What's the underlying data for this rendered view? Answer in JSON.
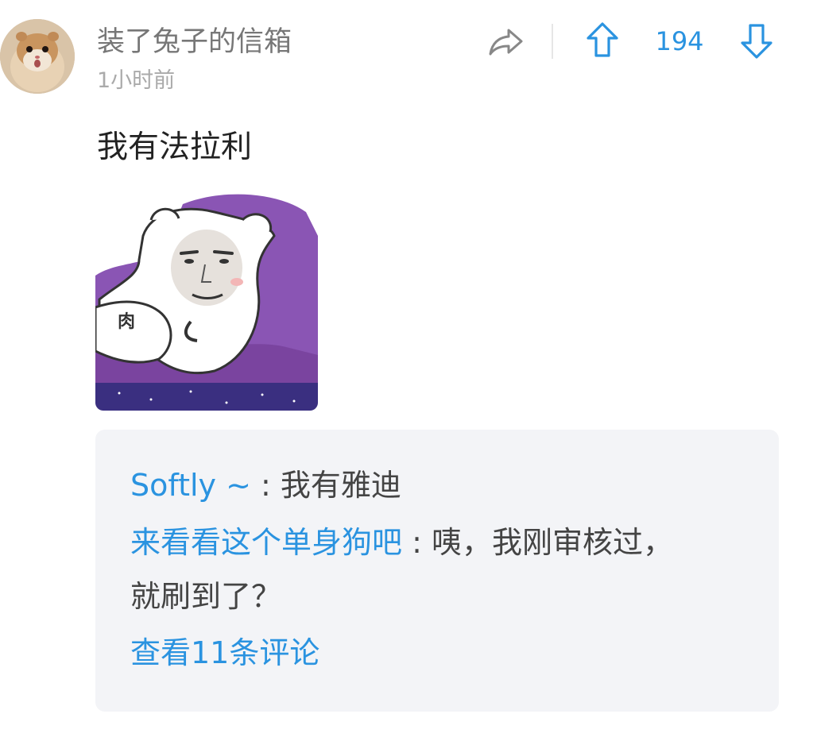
{
  "comment": {
    "username": "装了兔子的信箱",
    "timestamp": "1小时前",
    "text": "我有法拉利",
    "vote_count": "194",
    "sticker_caption": "肉"
  },
  "icons": {
    "share": "share-arrow-icon",
    "upvote": "arrow-up-icon",
    "downvote": "arrow-down-icon"
  },
  "replies": [
    {
      "author": "Softly ~",
      "separator": " : ",
      "text": "我有雅迪"
    },
    {
      "author": "来看看这个单身狗吧",
      "separator": " : ",
      "text": "咦，我刚审核过，就刷到了？"
    }
  ],
  "view_more_label": "查看11条评论",
  "colors": {
    "accent": "#2a93e0",
    "username": "#777777",
    "timestamp": "#aaaaaa",
    "reply_box_bg": "#f3f4f7",
    "icon_gray": "#888888"
  }
}
